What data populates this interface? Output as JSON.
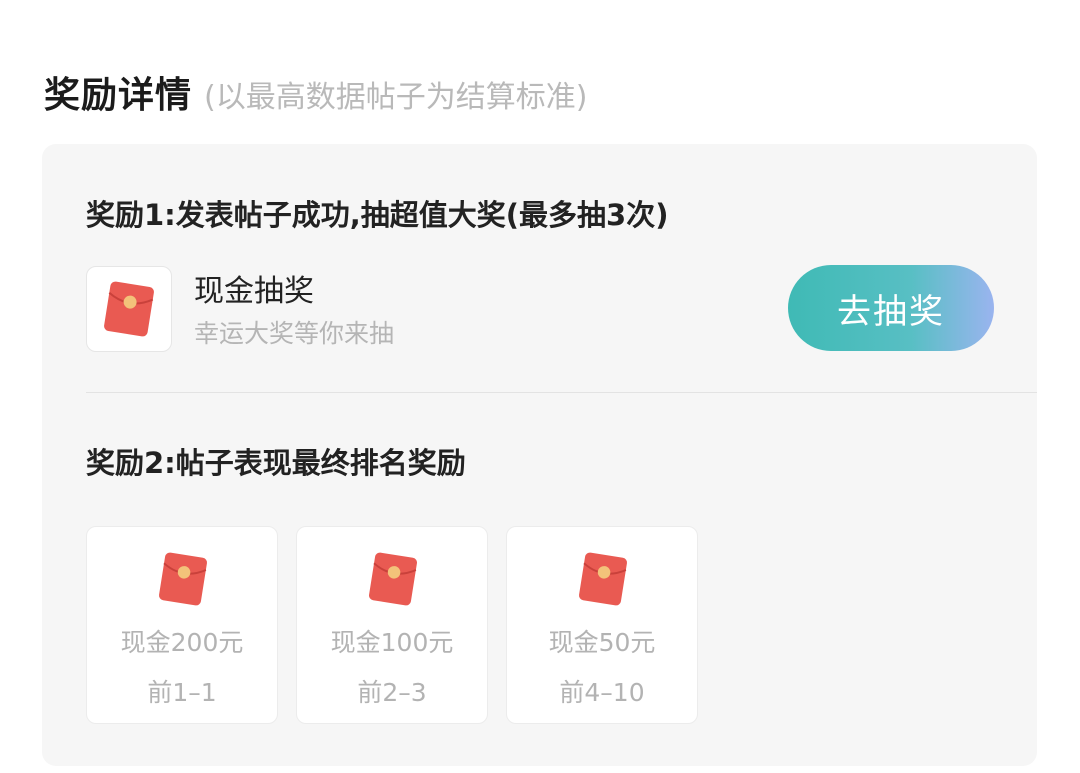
{
  "header": {
    "title": "奖励详情",
    "subtitle": "(以最高数据帖子为结算标准)"
  },
  "reward1": {
    "title": "奖励1:发表帖子成功,抽超值大奖(最多抽3次)",
    "item_name": "现金抽奖",
    "item_desc": "幸运大奖等你来抽",
    "button_label": "去抽奖",
    "icon": "red-envelope-icon"
  },
  "reward2": {
    "title": "奖励2:帖子表现最终排名奖励",
    "prizes": [
      {
        "amount": "现金200元",
        "rank": "前1–1",
        "icon": "red-envelope-icon"
      },
      {
        "amount": "现金100元",
        "rank": "前2–3",
        "icon": "red-envelope-icon"
      },
      {
        "amount": "现金50元",
        "rank": "前4–10",
        "icon": "red-envelope-icon"
      }
    ]
  },
  "colors": {
    "envelope_red": "#e95a52",
    "envelope_seal": "#f3c27a",
    "button_gradient_start": "#3fbab5",
    "button_gradient_end": "#9ab4ef",
    "panel_bg": "#f6f6f6"
  }
}
